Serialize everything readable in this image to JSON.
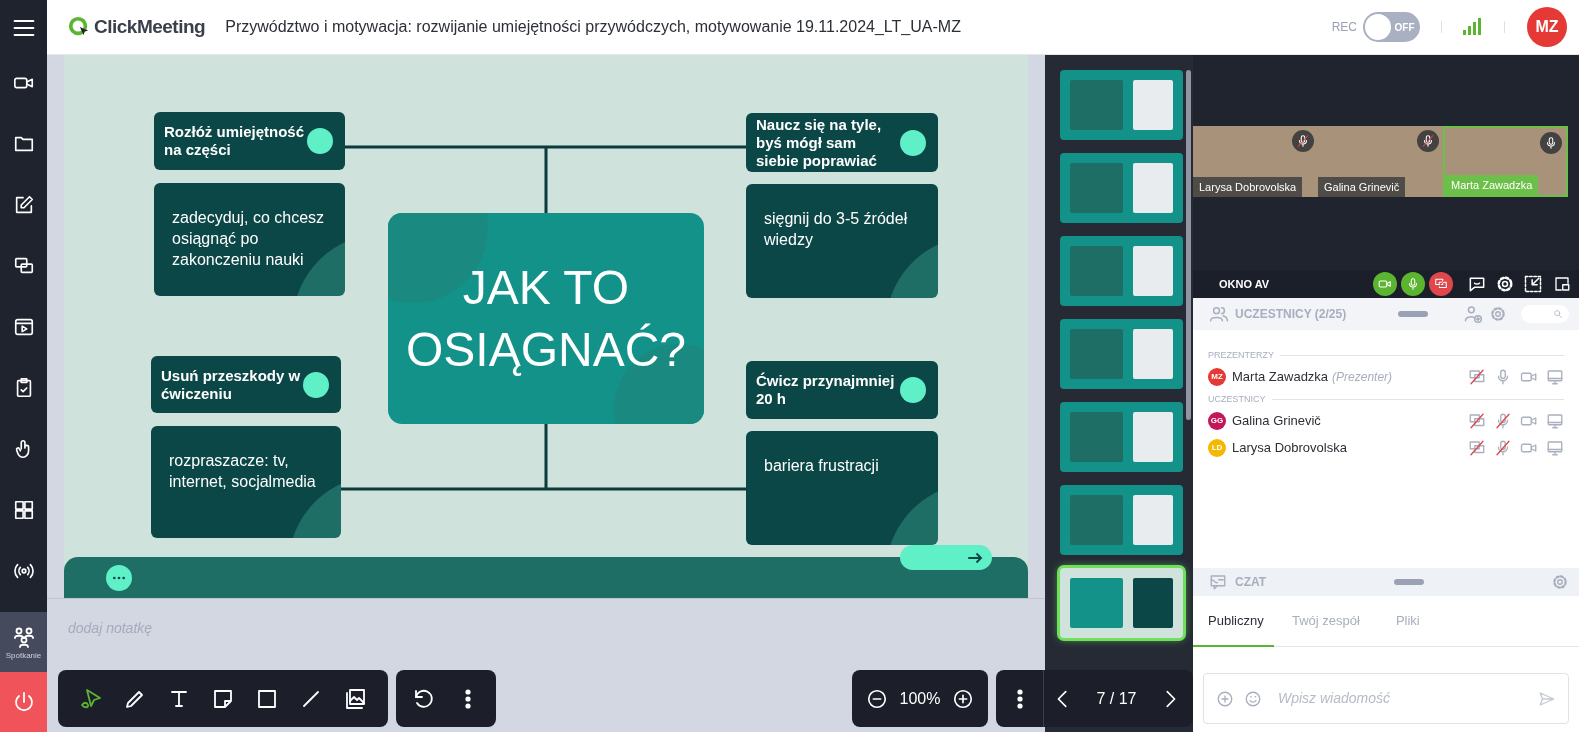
{
  "top_bar": {
    "logo": "ClickMeeting",
    "title": "Przywództwo i motywacja: rozwijanie umiejętności przywódczych, motywowanie 19.11.2024_LT_UA-MZ",
    "rec_label": "REC",
    "rec_toggle": {
      "on": false,
      "label": "OFF"
    },
    "avatar": "MZ"
  },
  "sidebar": {
    "items": [
      {
        "kind": "camera",
        "selected": false
      },
      {
        "kind": "folder",
        "selected": false
      },
      {
        "kind": "edit",
        "selected": false
      },
      {
        "kind": "screens",
        "selected": false
      },
      {
        "kind": "video",
        "selected": false
      },
      {
        "kind": "clipboard",
        "selected": false
      },
      {
        "kind": "touch",
        "selected": false
      },
      {
        "kind": "grid",
        "selected": false
      },
      {
        "kind": "broadcast",
        "selected": false
      },
      {
        "kind": "meeting",
        "label": "Spotkanie",
        "selected": true
      }
    ]
  },
  "slide": {
    "center_title": "JAK TO OSIĄGNAĆ?",
    "topics": [
      {
        "title": "Rozłóż umiejętność na części",
        "body": "zadecyduj, co chcesz osiągnąć po zakonczeniu nauki"
      },
      {
        "title": "Naucz się na tyle, byś mógł sam siebie poprawiać",
        "body": "sięgnij do 3-5 źródeł wiedzy"
      },
      {
        "title": "Usuń przeszkody w ćwiczeniu",
        "body": "rozpraszacze: tv, internet, socjalmedia"
      },
      {
        "title": "Ćwicz przynajmniej 20 h",
        "body": "bariera frustracji"
      }
    ]
  },
  "notes": {
    "placeholder": "dodaj notatkę"
  },
  "tools": [
    {
      "kind": "pointer",
      "selected": true
    },
    {
      "kind": "pencil",
      "selected": false
    },
    {
      "kind": "text",
      "selected": false
    },
    {
      "kind": "note",
      "selected": false
    },
    {
      "kind": "rectangle",
      "selected": false
    },
    {
      "kind": "line",
      "selected": false
    },
    {
      "kind": "image",
      "selected": false
    }
  ],
  "zoom": {
    "value": "100%"
  },
  "pager": {
    "current": "7 / 17"
  },
  "thumbnails": [
    {
      "selected": false
    },
    {
      "selected": false
    },
    {
      "selected": false
    },
    {
      "selected": false
    },
    {
      "selected": false
    },
    {
      "selected": false
    },
    {
      "selected": true
    }
  ],
  "video": {
    "tiles": [
      {
        "name": "Larysa Dobrovolska",
        "speaking": false,
        "muted": true
      },
      {
        "name": "Galina Grinevič",
        "speaking": false,
        "muted": true
      },
      {
        "name": "Marta Zawadzka",
        "speaking": true,
        "muted": false
      }
    ],
    "title": "OKNO AV",
    "controls": [
      {
        "kind": "camera",
        "on": true
      },
      {
        "kind": "mic",
        "on": true
      },
      {
        "kind": "screen",
        "on": false
      }
    ]
  },
  "participants": {
    "title": "UCZESTNICY (2/25)",
    "groups": [
      {
        "label": "PREZENTERZY",
        "people": [
          {
            "initials": "MZ",
            "name": "Marta Zawadzka",
            "role": "(Prezenter)",
            "color": "#e53935",
            "mic_muted": false
          }
        ]
      },
      {
        "label": "UCZESTNICY",
        "people": [
          {
            "initials": "GG",
            "name": "Galina Grinevič",
            "color": "#c2185b",
            "mic_muted": true
          },
          {
            "initials": "LD",
            "name": "Larysa Dobrovolska",
            "color": "#f5b800",
            "mic_muted": true
          }
        ]
      }
    ]
  },
  "chat": {
    "title": "CZAT",
    "tabs": [
      {
        "label": "Publiczny",
        "selected": true
      },
      {
        "label": "Twój zespół",
        "selected": false
      },
      {
        "label": "Pliki",
        "selected": false
      }
    ],
    "placeholder": "Wpisz wiadomość"
  }
}
